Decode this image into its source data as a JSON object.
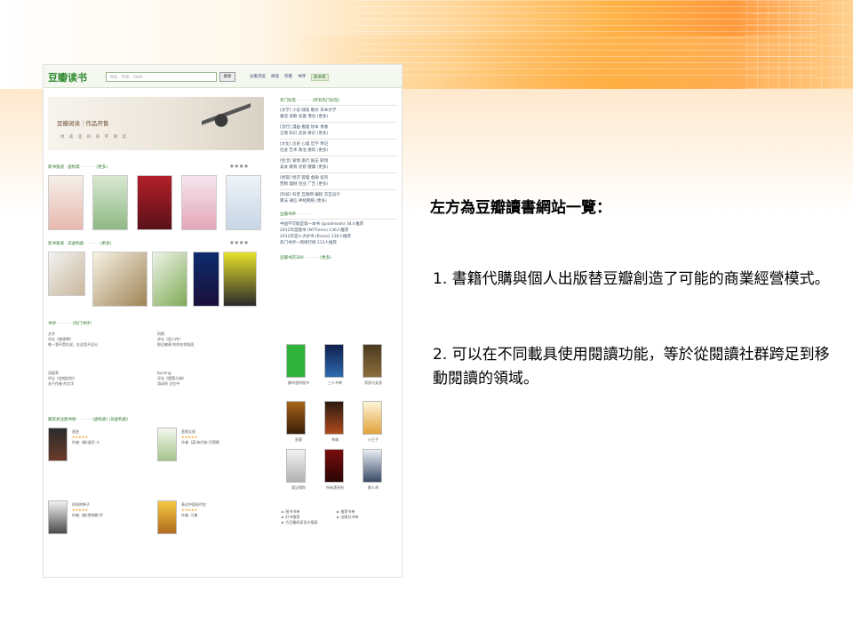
{
  "slide": {
    "heading": "左方為豆瓣讀書網站一覽：",
    "points": [
      "1.  書籍代購與個人出版替豆瓣創造了可能的商業經營模式。",
      "2.  可以在不同載具使用閱讀功能，等於從閱讀社群跨足到移動閱讀的領域。"
    ]
  },
  "screenshot": {
    "logo": "豆瓣读书",
    "search_placeholder": "书名、作者、ISBN",
    "search_button": "搜索",
    "nav": [
      "分类浏览",
      "阅读",
      "作者",
      "书评"
    ],
    "nav_pill": "购书单",
    "hero_title": "豆瓣阅读｜作品开售",
    "hero_sub": "尚 美 是 的 商 字 阅 读",
    "section1": "新书速递 · 虚构类 · · · · · · (更多)",
    "section2": "新书速递 · 非虚构类 · · · · · · (更多)",
    "section3": "书评 · · · · · · (热门书评)",
    "section4": "最受关注图书榜 · · · · · · (虚构类) (非虚构类)",
    "right_tags_title": "热门标签 · · · · · · (所有热门标签)",
    "right_tags": [
      "[文学]  小说  随笔  散文  日本文学",
      "童话  诗歌  名著  港台  (更多)",
      "[流行]  漫画  推理  绘本  青春",
      "言情  科幻  武侠  奇幻  (更多)",
      "[文化]  历史  心理  哲学  传记",
      "社会  艺术  政治  建筑  (更多)",
      "[生活]  爱情  旅行  励志  职场",
      "美食  教育  灵修  健康  (更多)",
      "[经管]  经济  管理  金融  投资",
      "营销  理财  创业  广告  (更多)",
      "[科技]  科普  互联网  编程  交互设计",
      "算法  通信  神经网络  (更多)"
    ],
    "right_list_title": "豆瓣书单 · · · · · ·",
    "right_list": [
      "中国不可能是第一本书 (goodreads)   34人推荐",
      "2012年度图书 (NYTimes)   136人推荐",
      "2012年度十大好书 (Bravo)   136人推荐",
      "热门书评一周排行榜   213人推荐"
    ],
    "right_books_title": "豆瓣书店280 · · · · · · (更多)",
    "right_books": [
      "都市里的秘书",
      "三人书单",
      "男孩与女孩",
      "恶意",
      "幸福",
      "小王子",
      "我记得你",
      "所有漂亮的",
      "野人鸡"
    ],
    "review_items": [
      [
        "文字",
        "评论《便便寒》",
        "唯一我不是在说，在这里不全分"
      ],
      [
        "阿德",
        "评论《里人传》",
        "那边感谢 的你在你前面"
      ],
      [
        "深夏草",
        "评论《会相信你》",
        "关于作者 的文字"
      ],
      [
        "burning",
        "评论《遗落与海》",
        "游动的 记忆中"
      ]
    ],
    "rank_items": [
      [
        "恶逆",
        "作者: (美)道尼·卡"
      ],
      [
        "直视太阳",
        "作者: (英)朱利安·巴恩斯"
      ],
      [
        "时间的种子",
        "作者: (美)詹姆斯·乔"
      ],
      [
        "表达中国现代史",
        "作者: 马勇"
      ]
    ],
    "footer_links": [
      "► 图书书单",
      "► 推荐书单",
      "► 好书推荐",
      "► 出版社书单",
      "► 为豆瓣阅读设计插画"
    ]
  },
  "colors": {
    "accent_green": "#2d8a2d",
    "banner_orange": "#ff9a3c"
  }
}
